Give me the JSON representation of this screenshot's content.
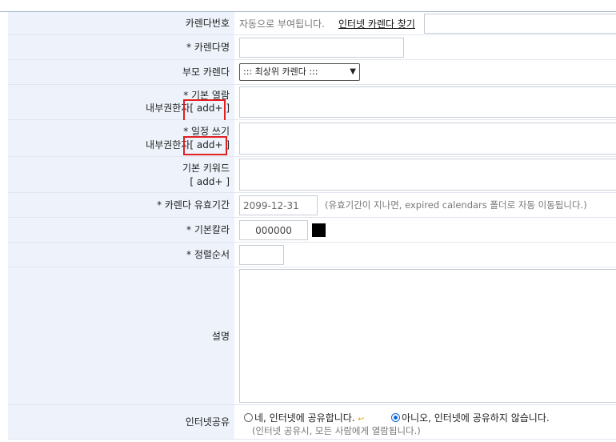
{
  "calendar_no": {
    "label": "카렌다번호",
    "auto_text": "자동으로 부여됩니다.",
    "find_link": "인터넷 카렌다 찾기"
  },
  "calendar_name": {
    "label": "* 카렌다명",
    "value": ""
  },
  "parent_calendar": {
    "label": "부모 카렌다",
    "selected": "::: 최상위 카렌다 :::"
  },
  "default_read": {
    "label_line1": "* 기본 열람",
    "label_line2": "내부권한자",
    "add": "[ add+ ]"
  },
  "schedule_write": {
    "label_line1": "* 일정 쓰기",
    "label_line2": "내부권한자",
    "add": "[ add+ ]"
  },
  "default_keyword": {
    "label_line1": "기본 키워드",
    "add": "[ add+ ]"
  },
  "validity": {
    "label": "* 카렌다 유효기간",
    "value": "2099-12-31",
    "note": "(유효기간이 지나면, expired calendars 폴더로 자동 이동됩니다.)"
  },
  "default_color": {
    "label": "* 기본칼라",
    "value": "000000",
    "swatch": "#000000"
  },
  "sort_order": {
    "label": "* 정렬순서",
    "value": ""
  },
  "description": {
    "label": "설명"
  },
  "internet_share": {
    "label": "인터넷공유",
    "yes": "네, 인터넷에 공유합니다.",
    "no": "아니오, 인터넷에 공유하지 않습니다.",
    "note": "(인터넷 공유시, 모든 사람에게 열람됩니다.)"
  }
}
